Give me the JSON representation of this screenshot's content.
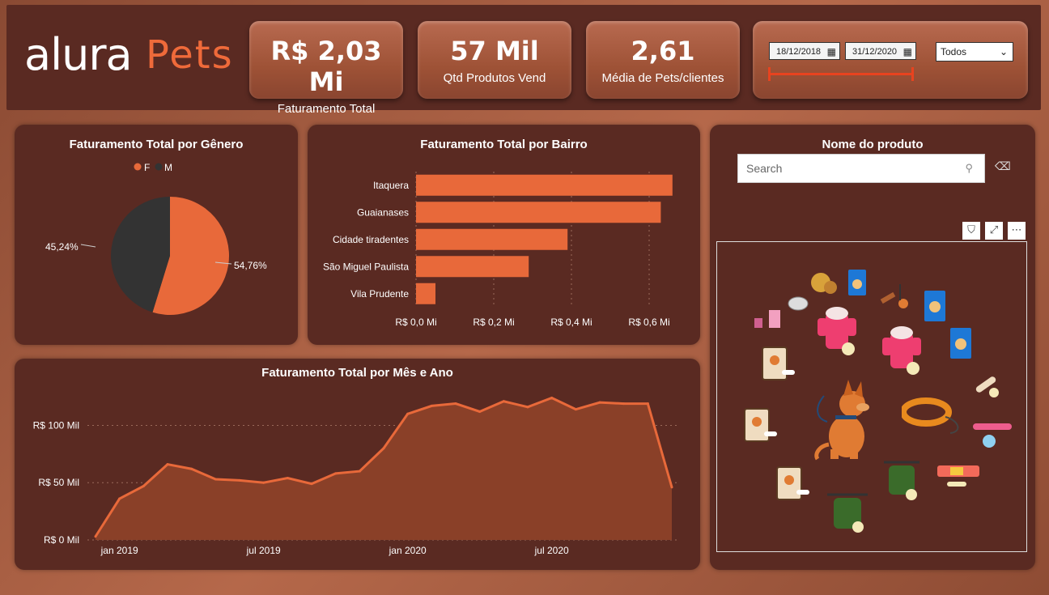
{
  "brand": {
    "part1": "alura",
    "part2": "Pets"
  },
  "kpis": [
    {
      "value": "R$ 2,03 Mi",
      "label": "Faturamento Total"
    },
    {
      "value": "57 Mil",
      "label": "Qtd Produtos Vend"
    },
    {
      "value": "2,61",
      "label": "Média de Pets/clientes"
    }
  ],
  "filters": {
    "date_start": "18/12/2018",
    "date_end": "31/12/2020",
    "dropdown_value": "Todos"
  },
  "colors": {
    "accent": "#e8693a",
    "background": "#5a2a22",
    "male": "#333333"
  },
  "pie": {
    "title": "Faturamento Total por Gênero",
    "legend": [
      "F",
      "M"
    ],
    "label_f": "54,76%",
    "label_m": "45,24%"
  },
  "bairro": {
    "title": "Faturamento Total por Bairro"
  },
  "line": {
    "title": "Faturamento Total por Mês e Ano"
  },
  "product_panel": {
    "title": "Nome do produto",
    "search_placeholder": "Search"
  },
  "icons": [
    "calendar-icon",
    "chevron-down-icon",
    "search-icon",
    "eraser-icon",
    "filter-icon",
    "focus-mode-icon",
    "more-options-icon"
  ],
  "chart_data": [
    {
      "type": "pie",
      "title": "Faturamento Total por Gênero",
      "categories": [
        "F",
        "M"
      ],
      "values": [
        54.76,
        45.24
      ],
      "legend": "top"
    },
    {
      "type": "bar",
      "title": "Faturamento Total por Bairro",
      "categories": [
        "Itaquera",
        "Guaianases",
        "Cidade tiradentes",
        "São Miguel Paulista",
        "Vila Prudente"
      ],
      "values": [
        0.66,
        0.63,
        0.39,
        0.29,
        0.05
      ],
      "unit": "R$ Mi",
      "xlim": [
        0,
        0.7
      ],
      "xticks": [
        "R$ 0,0 Mi",
        "R$ 0,2 Mi",
        "R$ 0,4 Mi",
        "R$ 0,6 Mi"
      ],
      "grid": true
    },
    {
      "type": "area",
      "title": "Faturamento Total por Mês e Ano",
      "x": [
        "2018-12",
        "2019-01",
        "2019-02",
        "2019-03",
        "2019-04",
        "2019-05",
        "2019-06",
        "2019-07",
        "2019-08",
        "2019-09",
        "2019-10",
        "2019-11",
        "2019-12",
        "2020-01",
        "2020-02",
        "2020-03",
        "2020-04",
        "2020-05",
        "2020-06",
        "2020-07",
        "2020-08",
        "2020-09",
        "2020-10",
        "2020-11",
        "2020-12"
      ],
      "values": [
        3,
        36,
        47,
        66,
        62,
        53,
        52,
        50,
        54,
        49,
        58,
        60,
        80,
        110,
        117,
        119,
        112,
        121,
        116,
        124,
        114,
        120,
        119,
        119,
        46
      ],
      "unit": "R$ Mil",
      "ylim": [
        0,
        130
      ],
      "yticks": [
        "R$ 0 Mil",
        "R$ 50 Mil",
        "R$ 100 Mil"
      ],
      "xticks": [
        "jan 2019",
        "jul 2019",
        "jan 2020",
        "jul 2020"
      ],
      "grid": true
    }
  ]
}
